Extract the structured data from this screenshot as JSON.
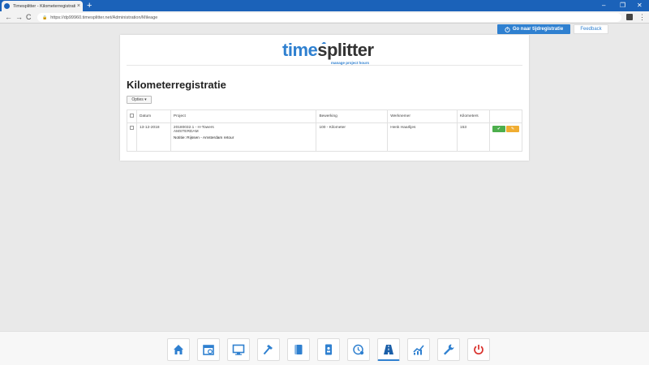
{
  "browser": {
    "tab_title": "Timesplitter - Kilometerregistrati",
    "tab_close": "×",
    "new_tab": "+",
    "url": "https://dp99960.timesplitter.net/Administration/Mileage",
    "minimize": "–",
    "restore": "❐",
    "close": "✕",
    "back": "←",
    "forward": "→",
    "reload": "C",
    "menu": "⋮"
  },
  "header": {
    "tijdregistratie_label": "Go naar tijdregistratie",
    "feedback_label": "Feedback"
  },
  "logo": {
    "part1": "time",
    "part2": "splitter",
    "tagline": "manage project hours"
  },
  "page": {
    "title": "Kilometerregistratie",
    "options_label": "Opties ▾"
  },
  "table": {
    "columns": [
      "Datum",
      "Project",
      "Bewerking",
      "Werknemer",
      "Kilometers"
    ],
    "rows": [
      {
        "datum": "13-12-2018",
        "project_line1": "20180032.1 - H-Towers",
        "project_line2": "AMSTERDAM",
        "notitie": "Notitie: Rijssen - Amsterdam retour",
        "bewerking": "100 - Kilometer",
        "werknemer": "Henk Haarlijes",
        "kilometers": "153"
      }
    ]
  },
  "dock": {
    "items": [
      {
        "icon": "home-icon",
        "active": false
      },
      {
        "icon": "calendar-icon",
        "active": false
      },
      {
        "icon": "monitor-icon",
        "active": false
      },
      {
        "icon": "hammer-icon",
        "active": false
      },
      {
        "icon": "notebook-icon",
        "active": false
      },
      {
        "icon": "badge-icon",
        "active": false
      },
      {
        "icon": "clock-history-icon",
        "active": false
      },
      {
        "icon": "road-icon",
        "active": true
      },
      {
        "icon": "chart-icon",
        "active": false
      },
      {
        "icon": "wrench-icon",
        "active": false
      },
      {
        "icon": "power-icon",
        "active": false
      }
    ]
  },
  "colors": {
    "accent": "#2f80d0",
    "success": "#4cae4c",
    "warning": "#f0ad32",
    "power": "#d9302b"
  }
}
